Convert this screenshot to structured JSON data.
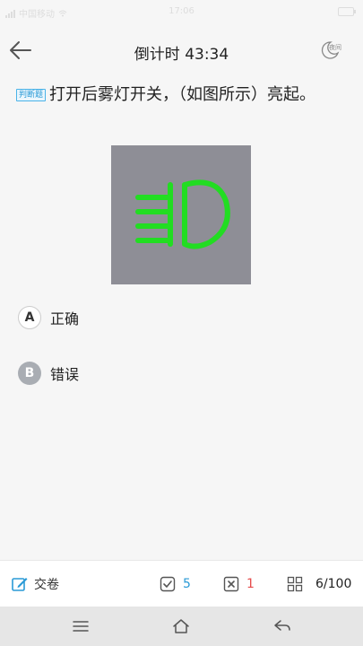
{
  "status": {
    "carrier": "中国移动",
    "time": "17:06"
  },
  "header": {
    "title": "倒计时 43:34",
    "night_label": "夜间"
  },
  "question": {
    "type_tag": "判断题",
    "text": "打开后雾灯开关，（如图所示）亮起。"
  },
  "options": [
    {
      "letter": "A",
      "label": "正确"
    },
    {
      "letter": "B",
      "label": "错误"
    }
  ],
  "bottom_bar": {
    "submit_label": "交卷",
    "correct_count": "5",
    "wrong_count": "1",
    "progress": "6/100"
  },
  "colors": {
    "accent_blue": "#2a9ad6",
    "wrong_red": "#e64c4c",
    "fog_light_green": "#22dd22",
    "figure_bg": "#8e8e96"
  },
  "icons": {
    "back": "back-arrow-icon",
    "night": "moon-icon",
    "submit": "edit-icon",
    "correct": "check-box-icon",
    "wrong": "x-box-icon",
    "grid": "grid-icon",
    "nav_menu": "menu-icon",
    "nav_home": "home-icon",
    "nav_back": "return-icon"
  }
}
